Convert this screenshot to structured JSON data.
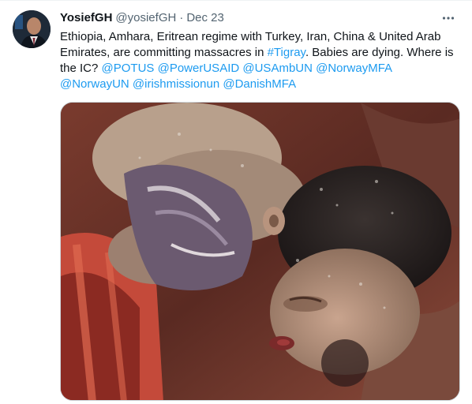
{
  "tweet": {
    "display_name": "YosiefGH",
    "handle": "@yosiefGH",
    "separator": "·",
    "date": "Dec 23",
    "more_icon": "more-horizontal-icon",
    "text_segments": [
      {
        "type": "text",
        "value": "Ethiopia, Amhara, Eritrean regime with Turkey, Iran, China & United Arab Emirates, are committing massacres in "
      },
      {
        "type": "link",
        "value": "#Tigray"
      },
      {
        "type": "text",
        "value": ". Babies are dying. Where is the IC? "
      },
      {
        "type": "link",
        "value": "@POTUS"
      },
      {
        "type": "text",
        "value": " "
      },
      {
        "type": "link",
        "value": "@PowerUSAID"
      },
      {
        "type": "text",
        "value": " "
      },
      {
        "type": "link",
        "value": "@USAmbUN"
      },
      {
        "type": "text",
        "value": " "
      },
      {
        "type": "link",
        "value": "@NorwayMFA"
      },
      {
        "type": "text",
        "value": " "
      },
      {
        "type": "link",
        "value": "@NorwayUN"
      },
      {
        "type": "text",
        "value": " "
      },
      {
        "type": "link",
        "value": "@irishmissionun"
      },
      {
        "type": "text",
        "value": " "
      },
      {
        "type": "link",
        "value": "@DanishMFA"
      }
    ]
  },
  "colors": {
    "text": "#0f1419",
    "secondary": "#536471",
    "link": "#1d9bf0",
    "border": "#cfd9de"
  }
}
